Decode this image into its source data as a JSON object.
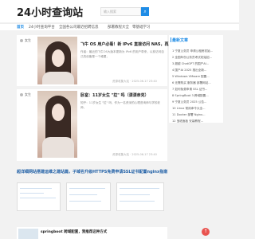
{
  "header": {
    "logo": "24小时查询站",
    "search_placeholder": "输入搜索",
    "search_icon": "search-icon"
  },
  "nav": {
    "items": [
      "首页",
      "24小时查询平台",
      "全国各公司最近招聘信息",
      "部署教程大全",
      "零基础学习"
    ]
  },
  "cards": [
    {
      "tag": "女生",
      "title": "飞牛 OS 用户必看！新 IPv6 直接访问 NAS，再见 D...",
      "excerpt": "作者：最近的飞牛OS大版本更新为 IPv6 的用户带来，以前访问自己的设备是一个难题，",
      "meta": "资源收集大站 · 2025-06-17 23:40"
    },
    {
      "tag": "女生",
      "title": "卧室：11岁女生 \"拉\" 吗（漂漂亲克）",
      "excerpt": "知乎：11岁女生 \"拉\" 吗，作为一名资深的心理咨询师与学校老师，",
      "meta": "资源收集大站 · 2025-06-17 23:40"
    }
  ],
  "sidebar": {
    "heading": "最新文章",
    "items": [
      "1 宁夏公务员 申请公租房初始...",
      "2 全国年份公务员考试初始招...",
      "3 超越 ChatGPT 的国产AI...",
      "4 国产AI 2025 推出全新...",
      "5 Windows VMware 配置...",
      "6 无需购买 服务器 部署网站...",
      "7 如何免费申请 SSL 证书...",
      "8 SpringBoot 3 跨域配置...",
      "9 宁夏公务员 2025 公告...",
      "10 Linux 常用命令大全...",
      "11 Docker 部署 Nginx...",
      "12 宝塔面板 安装教程..."
    ]
  },
  "headline": "超详细网站搭建运维之建站篇，子域名升级HTTPS免费申请SSL证书配置nginx指南",
  "bottom_card": {
    "title": "springboot 跨域配置，我推荐这种方式"
  },
  "fab_icon": "arrow-up-icon"
}
